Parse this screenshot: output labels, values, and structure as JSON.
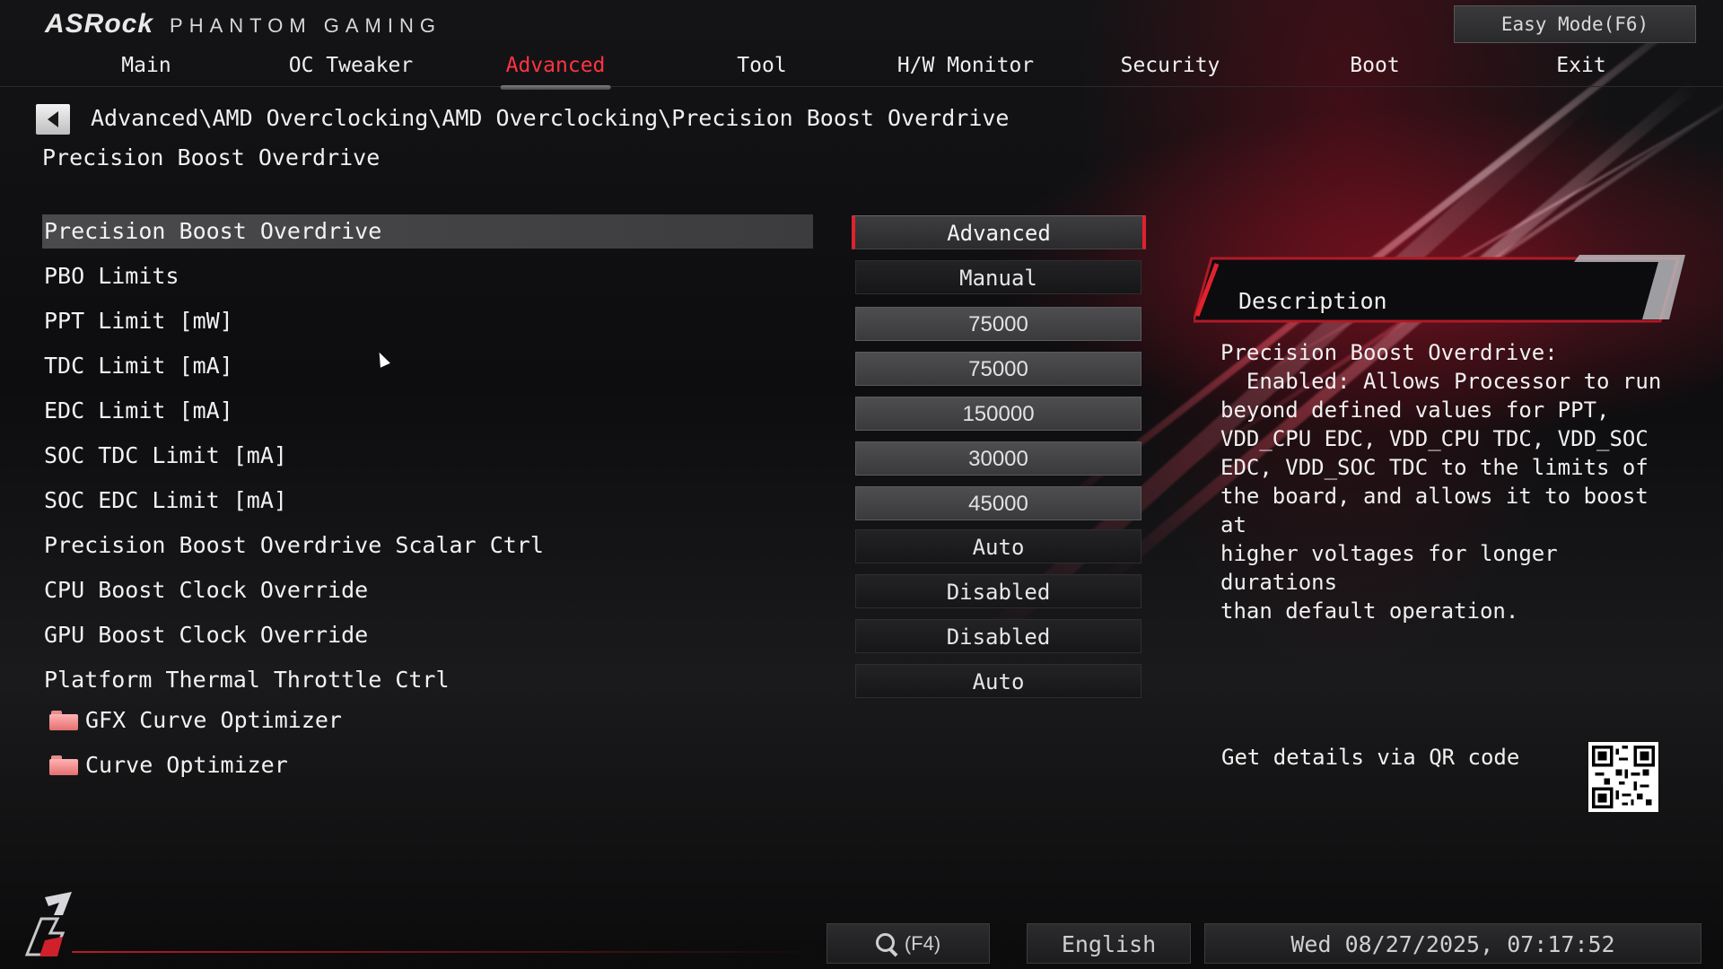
{
  "brand": {
    "logo": "ASRock",
    "subtitle": "PHANTOM GAMING"
  },
  "easy_mode_label": "Easy Mode(F6)",
  "nav": {
    "tabs": [
      {
        "label": "Main"
      },
      {
        "label": "OC Tweaker"
      },
      {
        "label": "Advanced"
      },
      {
        "label": "Tool"
      },
      {
        "label": "H/W Monitor"
      },
      {
        "label": "Security"
      },
      {
        "label": "Boot"
      },
      {
        "label": "Exit"
      }
    ],
    "active": "Advanced"
  },
  "breadcrumb": "Advanced\\AMD Overclocking\\AMD Overclocking\\Precision Boost Overdrive",
  "page_title": "Precision Boost Overdrive",
  "settings": [
    {
      "label": "Precision Boost Overdrive",
      "value": "Advanced"
    },
    {
      "label": "PBO Limits",
      "value": "Manual"
    },
    {
      "label": "PPT Limit [mW]",
      "value": "75000"
    },
    {
      "label": "TDC Limit [mA]",
      "value": "75000"
    },
    {
      "label": "EDC Limit [mA]",
      "value": "150000"
    },
    {
      "label": "SOC TDC Limit [mA]",
      "value": "30000"
    },
    {
      "label": "SOC EDC Limit [mA]",
      "value": "45000"
    },
    {
      "label": "Precision Boost Overdrive Scalar Ctrl",
      "value": "Auto"
    },
    {
      "label": "CPU Boost Clock Override",
      "value": "Disabled"
    },
    {
      "label": "GPU Boost Clock Override",
      "value": "Disabled"
    },
    {
      "label": "Platform Thermal Throttle Ctrl",
      "value": "Auto"
    }
  ],
  "submenus": [
    {
      "label": "GFX Curve Optimizer"
    },
    {
      "label": "Curve Optimizer"
    }
  ],
  "description": {
    "title": "Description",
    "text": "Precision Boost Overdrive:\n  Enabled: Allows Processor to run\nbeyond defined values for PPT,\nVDD_CPU EDC, VDD_CPU TDC, VDD_SOC\nEDC, VDD_SOC TDC to the limits of\nthe board, and allows it to boost at\nhigher voltages for longer durations\nthan default operation."
  },
  "qr_label": "Get details via QR code",
  "bottom": {
    "search_key": "(F4)",
    "language": "English",
    "datetime": "Wed 08/27/2025, 07:17:52"
  },
  "colors": {
    "accent": "#e0222e",
    "active_tab": "#ff3440",
    "folder": "#f09a9a"
  },
  "icons": [
    "back-arrow-icon",
    "folder-icon",
    "search-icon",
    "qr-code-icon",
    "mouse-cursor-icon",
    "brand-corner-logo-icon"
  ]
}
